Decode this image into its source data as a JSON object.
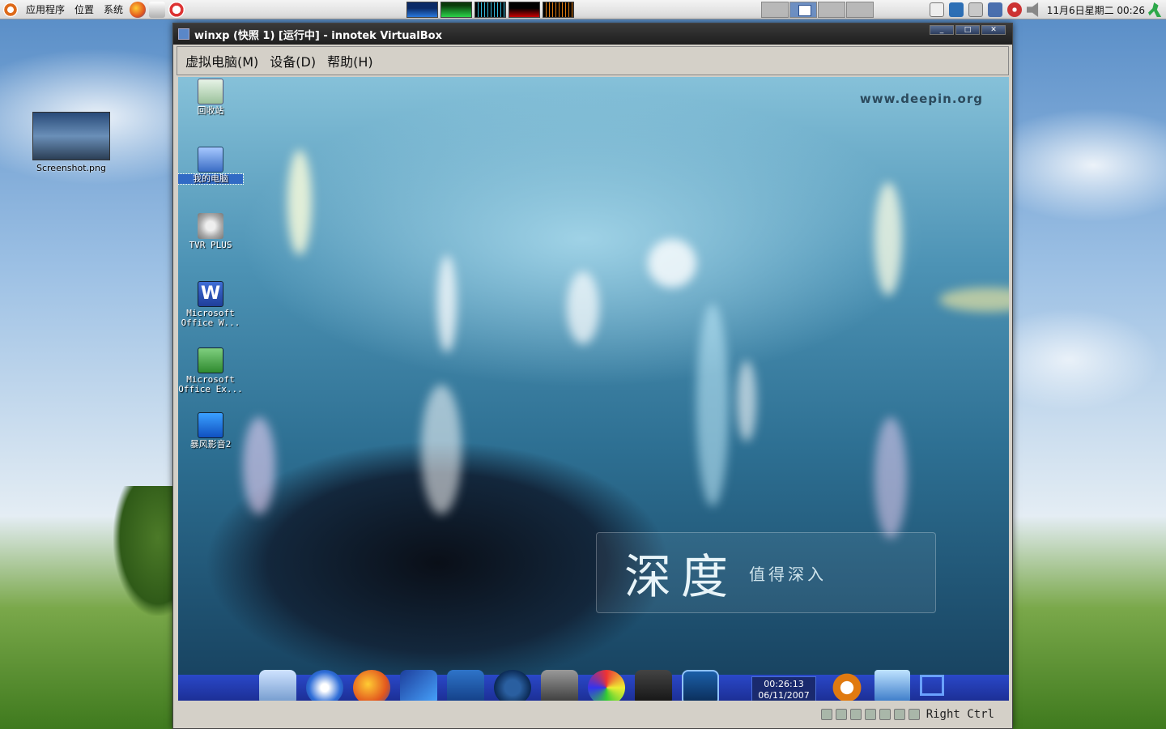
{
  "top_panel": {
    "menus": [
      "应用程序",
      "位置",
      "系统"
    ],
    "launchers": [
      "firefox-icon",
      "mail-icon",
      "help-icon"
    ],
    "clock": "11月6日星期二 00:26"
  },
  "desktop": {
    "file_icon_label": "Screenshot.png"
  },
  "vbox_window": {
    "title": "winxp (快照 1) [运行中] - innotek VirtualBox",
    "menus": [
      "虚拟电脑(M)",
      "设备(D)",
      "帮助(H)"
    ],
    "host_key": "Right Ctrl"
  },
  "guest": {
    "site_url": "www.deepin.org",
    "brand_main": "深度",
    "brand_tag": "值得深入",
    "icons": [
      {
        "label": "回收站",
        "icon": "recycle-bin-icon"
      },
      {
        "label": "我的电脑",
        "icon": "my-computer-icon"
      },
      {
        "label": "TVR PLUS",
        "icon": "tvr-plus-icon"
      },
      {
        "label": "Microsoft Office W...",
        "icon": "word-icon"
      },
      {
        "label": "Microsoft Office Ex...",
        "icon": "excel-icon"
      },
      {
        "label": "暴风影音2",
        "icon": "storm-player-icon"
      }
    ],
    "dock_clock_time": "00:26:13",
    "dock_clock_date": "06/11/2007"
  }
}
